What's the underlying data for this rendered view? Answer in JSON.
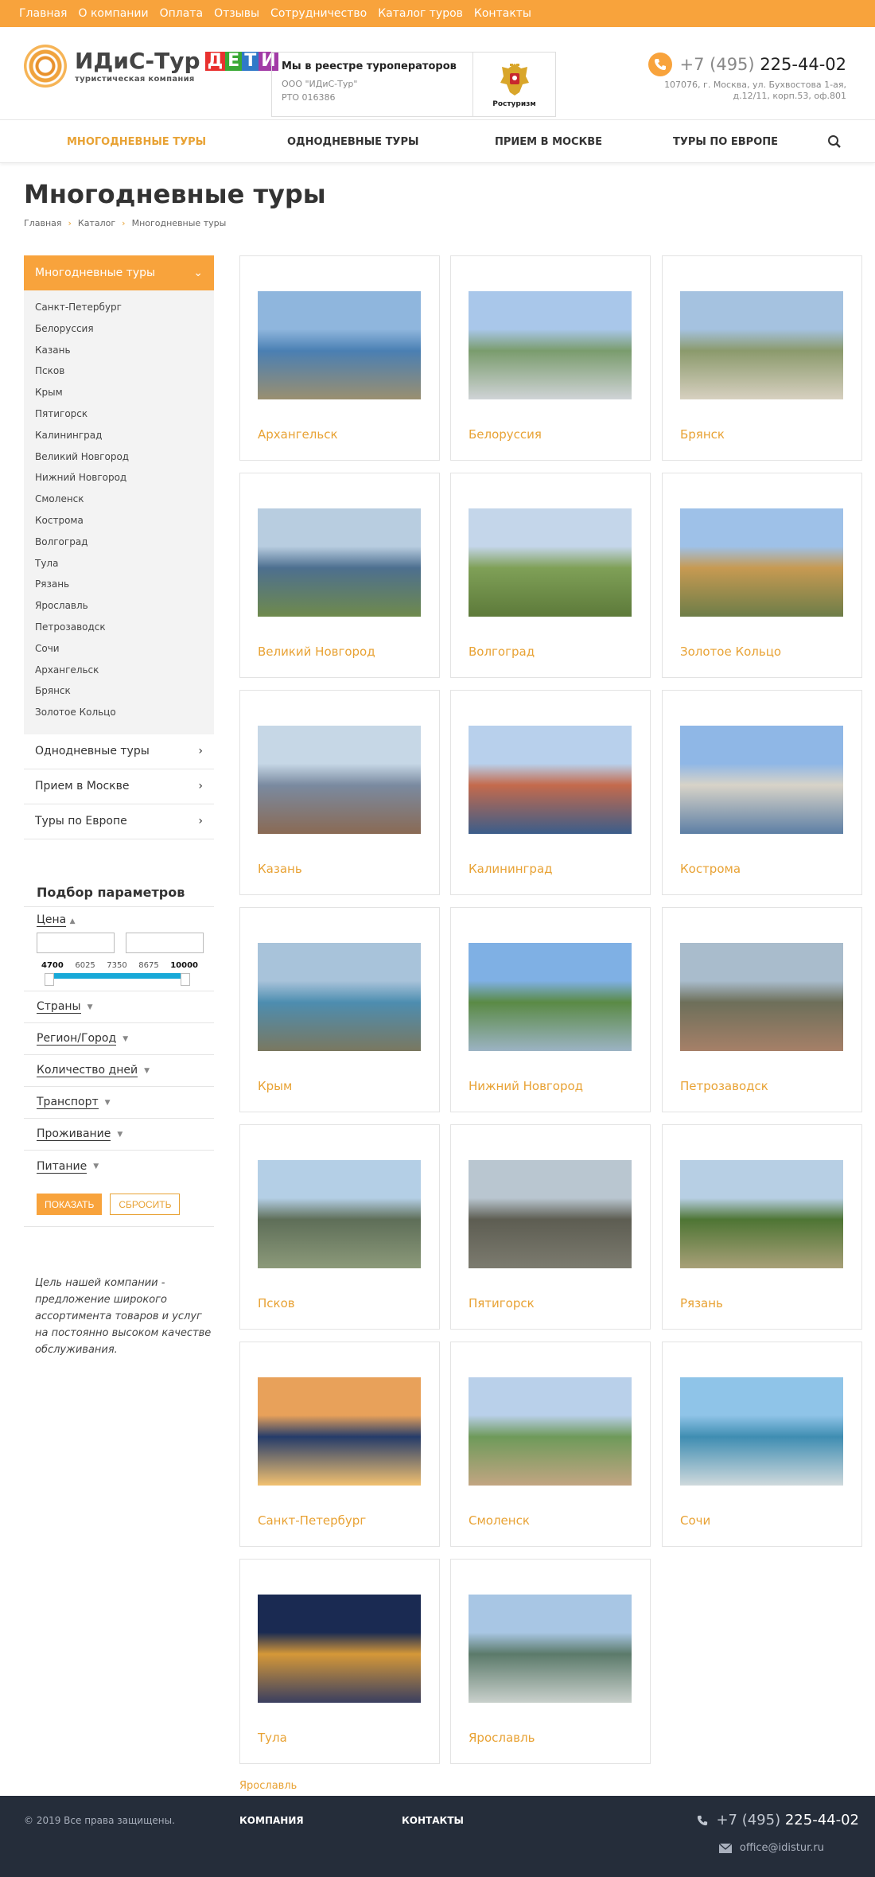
{
  "topbar": {
    "links": [
      "Главная",
      "О компании",
      "Оплата",
      "Отзывы",
      "Сотрудничество",
      "Каталог туров",
      "Контакты"
    ]
  },
  "logo": {
    "title": "ИДиС-Тур",
    "kids": [
      "Д",
      "Е",
      "Т",
      "И"
    ],
    "kids_colors": [
      "#e8312f",
      "#3aa935",
      "#2f79c8",
      "#a23aa6"
    ],
    "subtitle": "туристическая компания"
  },
  "registry": {
    "title": "Мы в реестре туроператоров",
    "company": "ООО \"ИДиС-Тур\"",
    "rto": "РТО 016386",
    "emblem_label": "Ростуризм"
  },
  "contacts": {
    "phone_prefix": "+7 (495)",
    "phone_number": "225-44-02",
    "address_1": "107076, г. Москва, ул. Бухвостова 1-ая,",
    "address_2": "д.12/11, корп.53, оф.801"
  },
  "nav": {
    "items": [
      "МНОГОДНЕВНЫЕ ТУРЫ",
      "ОДНОДНЕВНЫЕ ТУРЫ",
      "ПРИЕМ В МОСКВЕ",
      "ТУРЫ ПО ЕВРОПЕ"
    ],
    "active": 0
  },
  "page": {
    "title": "Многодневные туры",
    "breadcrumb": [
      "Главная",
      "Каталог",
      "Многодневные туры"
    ]
  },
  "sidebar": {
    "head": "Многодневные туры",
    "sub_items": [
      "Санкт-Петербург",
      "Белоруссия",
      "Казань",
      "Псков",
      "Крым",
      "Пятигорск",
      "Калининград",
      "Великий Новгород",
      "Нижний Новгород",
      "Смоленск",
      "Кострома",
      "Волгоград",
      "Тула",
      "Рязань",
      "Ярославль",
      "Петрозаводск",
      "Сочи",
      "Архангельск",
      "Брянск",
      "Золотое Кольцо"
    ],
    "links": [
      "Однодневные туры",
      "Прием в Москве",
      "Туры по Европе"
    ]
  },
  "filter": {
    "title": "Подбор параметров",
    "price_label": "Цена",
    "scale": [
      "4700",
      "6025",
      "7350",
      "8675",
      "10000"
    ],
    "rows": [
      "Страны",
      "Регион/Город",
      "Количество дней",
      "Транспорт",
      "Проживание",
      "Питание"
    ],
    "show": "ПОКАЗАТЬ",
    "reset": "СБРОСИТЬ"
  },
  "mission": "Цель нашей компании - предложение широкого ассортимента товаров и услуг на постоянно высоком качестве обслуживания.",
  "tours": [
    "Архангельск",
    "Белоруссия",
    "Брянск",
    "Великий Новгород",
    "Волгоград",
    "Золотое Кольцо",
    "Казань",
    "Калининград",
    "Кострома",
    "Крым",
    "Нижний Новгород",
    "Петрозаводск",
    "Псков",
    "Пятигорск",
    "Рязань",
    "Санкт-Петербург",
    "Смоленск",
    "Сочи",
    "Тула",
    "Ярославль"
  ],
  "bottom_link": "Ярославль",
  "footer": {
    "copyright": "© 2019 Все права защищены.",
    "nav": [
      "КОМПАНИЯ",
      "КОНТАКТЫ"
    ],
    "phone_prefix": "+7 (495)",
    "phone_number": "225-44-02",
    "email": "office@idistur.ru"
  },
  "colors": {
    "accent": "#f8a33c",
    "link": "#e8a234",
    "footer_bg": "#252d3a",
    "slider": "#18a9d8"
  }
}
